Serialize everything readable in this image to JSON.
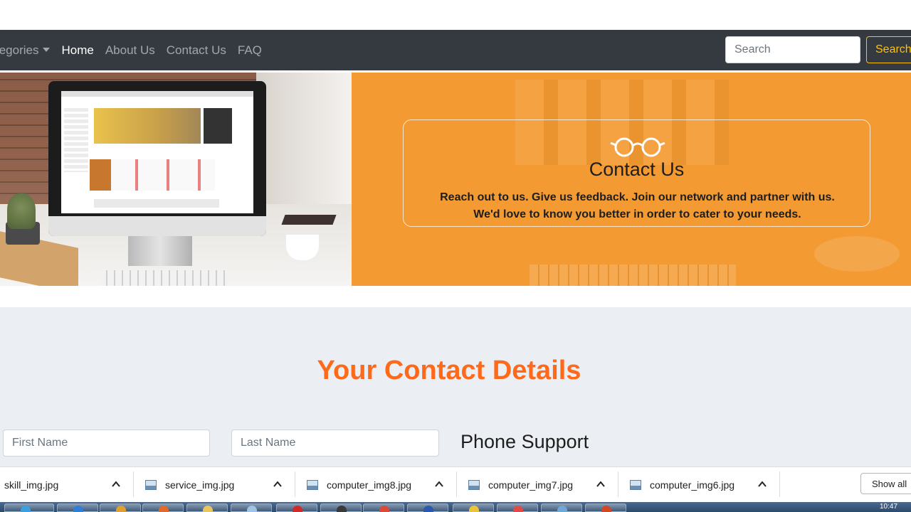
{
  "navbar": {
    "categories_label": "tegories",
    "links": [
      "Home",
      "About Us",
      "Contact Us",
      "FAQ"
    ],
    "active": "Home",
    "search_placeholder": "Search",
    "search_button": "Search"
  },
  "hero": {
    "title": "Contact Us",
    "line1": "Reach out to us. Give us feedback. Join our network and partner with us.",
    "line2": "We'd love to know you better in order to cater to your needs."
  },
  "contact": {
    "title": "Your Contact Details",
    "first_name_placeholder": "First Name",
    "last_name_placeholder": "Last Name",
    "phone_support": "Phone Support"
  },
  "downloads": {
    "files": [
      "skill_img.jpg",
      "service_img.jpg",
      "computer_img8.jpg",
      "computer_img7.jpg",
      "computer_img6.jpg"
    ],
    "show_all": "Show all"
  },
  "taskbar": {
    "clock": "10:47"
  },
  "colors": {
    "navbar": "#343a40",
    "accent_orange": "#f39a32",
    "section_title": "#ff6a1a",
    "search_button": "#ffc107"
  }
}
